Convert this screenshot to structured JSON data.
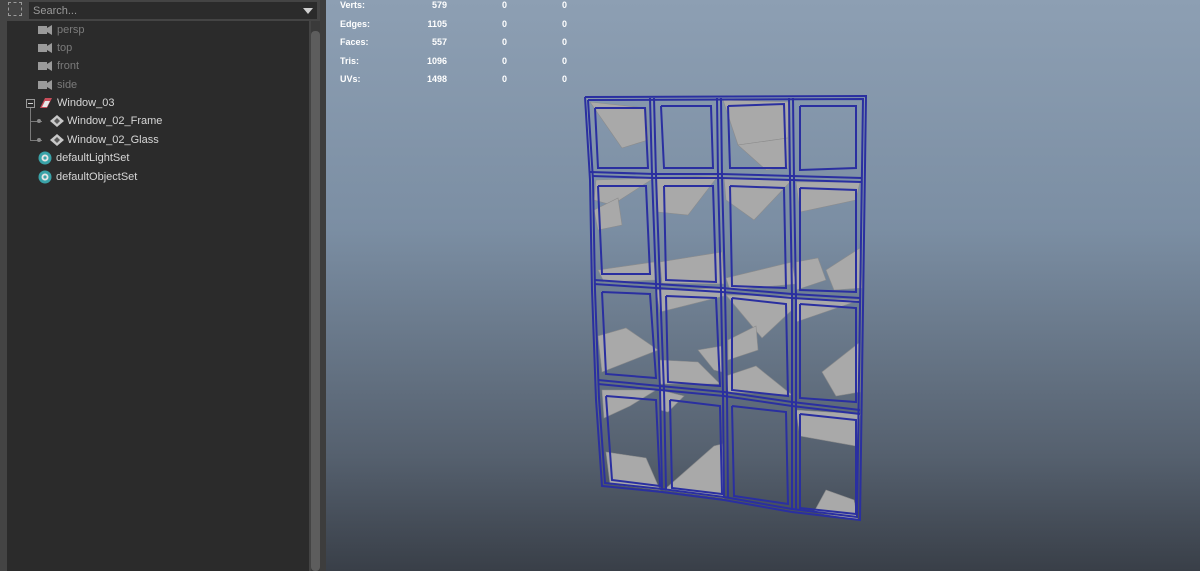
{
  "outliner": {
    "search_placeholder": "Search...",
    "items": [
      {
        "label": "persp",
        "icon": "camera-icon"
      },
      {
        "label": "top",
        "icon": "camera-icon"
      },
      {
        "label": "front",
        "icon": "camera-icon"
      },
      {
        "label": "side",
        "icon": "camera-icon"
      },
      {
        "label": "Window_03",
        "icon": "group-transform-icon"
      },
      {
        "label": "Window_02_Frame",
        "icon": "mesh-transform-icon"
      },
      {
        "label": "Window_02_Glass",
        "icon": "mesh-transform-icon"
      },
      {
        "label": "defaultLightSet",
        "icon": "set-icon"
      },
      {
        "label": "defaultObjectSet",
        "icon": "set-icon"
      }
    ]
  },
  "hud": {
    "rows": [
      {
        "label": "Verts:",
        "v1": "579",
        "v2": "0",
        "v3": "0"
      },
      {
        "label": "Edges:",
        "v1": "1105",
        "v2": "0",
        "v3": "0"
      },
      {
        "label": "Faces:",
        "v1": "557",
        "v2": "0",
        "v3": "0"
      },
      {
        "label": "Tris:",
        "v1": "1096",
        "v2": "0",
        "v3": "0"
      },
      {
        "label": "UVs:",
        "v1": "1498",
        "v2": "0",
        "v3": "0"
      }
    ]
  },
  "colors": {
    "wireframe": "#2a2fa0",
    "glass_fill": "#a9a9a9",
    "outliner_bg": "#2b2b2b"
  }
}
